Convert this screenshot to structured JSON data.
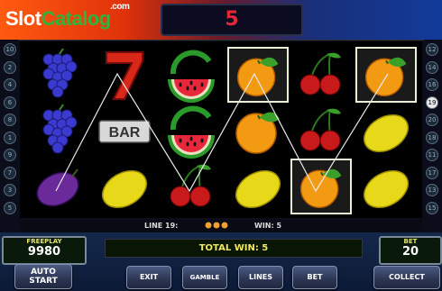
{
  "logo": {
    "part1": "Slot",
    "part2": "Catalog",
    "suffix": ".com"
  },
  "win_display": "5",
  "left_lines": [
    "10",
    "2",
    "4",
    "6",
    "8",
    "1",
    "9",
    "7",
    "3",
    "5"
  ],
  "right_lines": [
    "12",
    "14",
    "16",
    "19",
    "20",
    "18",
    "11",
    "17",
    "13",
    "15"
  ],
  "active_line": "19",
  "reels": [
    [
      "grapes",
      "seven",
      "watermelon",
      "orange",
      "cherries",
      "orange"
    ],
    [
      "grapes",
      "bar",
      "watermelon",
      "orange",
      "cherries",
      "lemon"
    ],
    [
      "plum",
      "lemon",
      "cherries",
      "lemon",
      "orange",
      "lemon"
    ]
  ],
  "highlighted": [
    [
      0,
      3
    ],
    [
      0,
      5
    ],
    [
      2,
      4
    ]
  ],
  "symbol_text": {
    "bar": "BAR"
  },
  "infobar": {
    "line": "LINE 19:",
    "win": "WIN: 5"
  },
  "freeplay": {
    "label": "FREEPLAY",
    "value": "9980"
  },
  "total_win": "TOTAL WIN: 5",
  "bet_box": {
    "label": "BET",
    "value": "20"
  },
  "buttons": {
    "auto_start_line1": "AUTO",
    "auto_start_line2": "START",
    "exit": "EXIT",
    "gamble": "GAMBLE",
    "lines": "LINES",
    "bet": "BET",
    "collect": "COLLECT"
  },
  "colors": {
    "win_red": "#e3263a",
    "lcd_yellow": "#f0e860",
    "logo_green": "#2fb33c"
  }
}
